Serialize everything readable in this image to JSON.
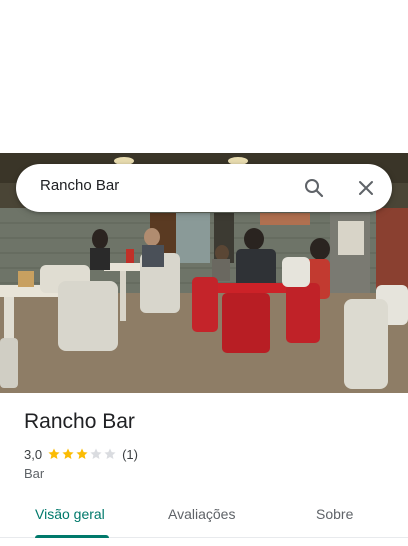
{
  "search": {
    "query": "Rancho Bar"
  },
  "icons": {
    "search": "search-icon",
    "close": "close-icon"
  },
  "place": {
    "name": "Rancho Bar",
    "rating": "3,0",
    "rating_stars": 3,
    "max_stars": 5,
    "review_count": "(1)",
    "category": "Bar"
  },
  "tabs": [
    {
      "label": "Visão geral",
      "active": true
    },
    {
      "label": "Avaliações",
      "active": false
    },
    {
      "label": "Sobre",
      "active": false
    }
  ],
  "colors": {
    "accent": "#00796b",
    "star_filled": "#fbbc04",
    "star_empty": "#dadce0"
  }
}
